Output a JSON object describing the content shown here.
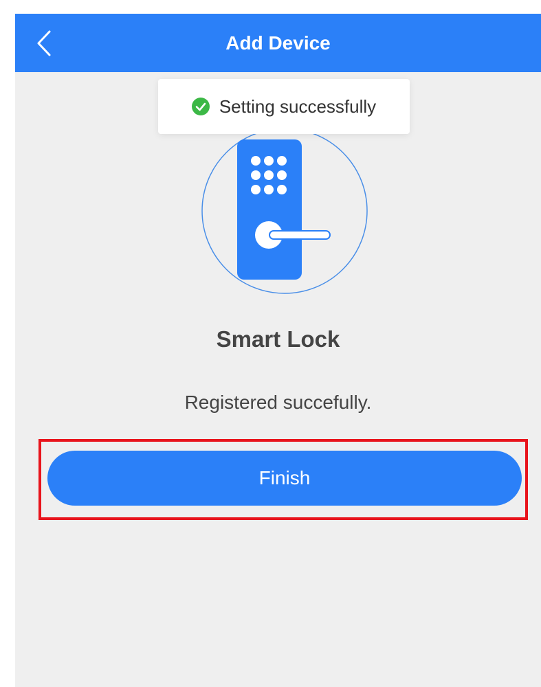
{
  "header": {
    "title": "Add Device",
    "back_icon": "chevron-left-icon",
    "background_color": "#2b80f8"
  },
  "toast": {
    "icon": "check-circle-icon",
    "icon_color": "#3cb846",
    "message": "Setting successfully"
  },
  "device": {
    "illustration_icon": "smart-lock-icon",
    "name": "Smart Lock",
    "status": "Registered succefully."
  },
  "actions": {
    "finish_label": "Finish",
    "accent_color": "#2b80f8",
    "highlight_color": "#e8141c"
  }
}
